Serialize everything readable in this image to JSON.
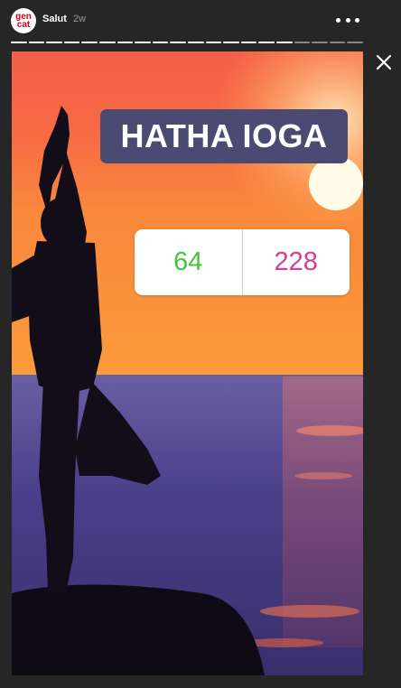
{
  "header": {
    "avatar_line1": "gen",
    "avatar_line2": "cat",
    "username": "Salut",
    "time": "2w",
    "more_icon": "more-horizontal-icon",
    "close_icon": "close-icon"
  },
  "progress": {
    "segments_total": 20,
    "segments_viewed": 16
  },
  "story": {
    "title": "HATHA IOGA",
    "title_bg": "#4a4a72",
    "poll": {
      "left_value": "64",
      "right_value": "228",
      "left_color": "#46c33a",
      "right_color": "#e0398e"
    }
  }
}
